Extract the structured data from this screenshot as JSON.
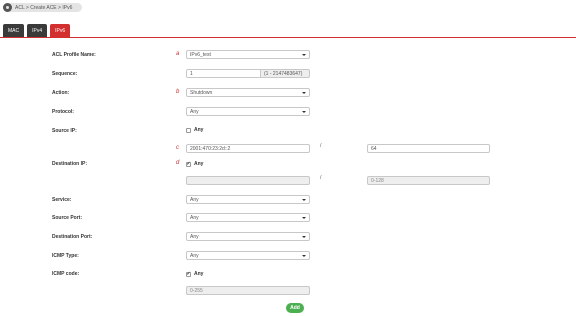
{
  "breadcrumb": {
    "text": "ACL > Create ACE > IPv6"
  },
  "tabs": [
    {
      "label": "MAC",
      "active": false
    },
    {
      "label": "IPv4",
      "active": false
    },
    {
      "label": "IPv6",
      "active": true
    }
  ],
  "form": {
    "acl_profile_name": {
      "label": "ACL Profile Name:",
      "value": "IPv6_test",
      "marker": "a"
    },
    "sequence": {
      "label": "Sequence:",
      "value": "1",
      "hint": "(1 - 2147483647)"
    },
    "action": {
      "label": "Action:",
      "value": "Shutdown",
      "marker": "b"
    },
    "protocol": {
      "label": "Protocol:",
      "value": "Any"
    },
    "source_ip": {
      "label": "Source IP:",
      "any_label": "Any",
      "any_checked": false,
      "address": "2001:470:23:2d::2",
      "prefix": "64",
      "marker": "c",
      "slash": "/"
    },
    "destination_ip": {
      "label": "Destination IP:",
      "any_label": "Any",
      "any_checked": true,
      "address": "",
      "prefix_placeholder": "0-128",
      "marker": "d",
      "slash": "/"
    },
    "service": {
      "label": "Service:",
      "value": "Any"
    },
    "source_port": {
      "label": "Source Port:",
      "value": "Any"
    },
    "destination_port": {
      "label": "Destination Port:",
      "value": "Any"
    },
    "icmp_type": {
      "label": "ICMP Type:",
      "value": "Any"
    },
    "icmp_code": {
      "label": "ICMP code:",
      "any_label": "Any",
      "any_checked": true,
      "placeholder": "0-255"
    }
  },
  "add_button": {
    "label": "Add"
  },
  "colors": {
    "accent": "#d32f2f",
    "tab_dark": "#3a3a3a",
    "add_green": "#4caf50"
  }
}
